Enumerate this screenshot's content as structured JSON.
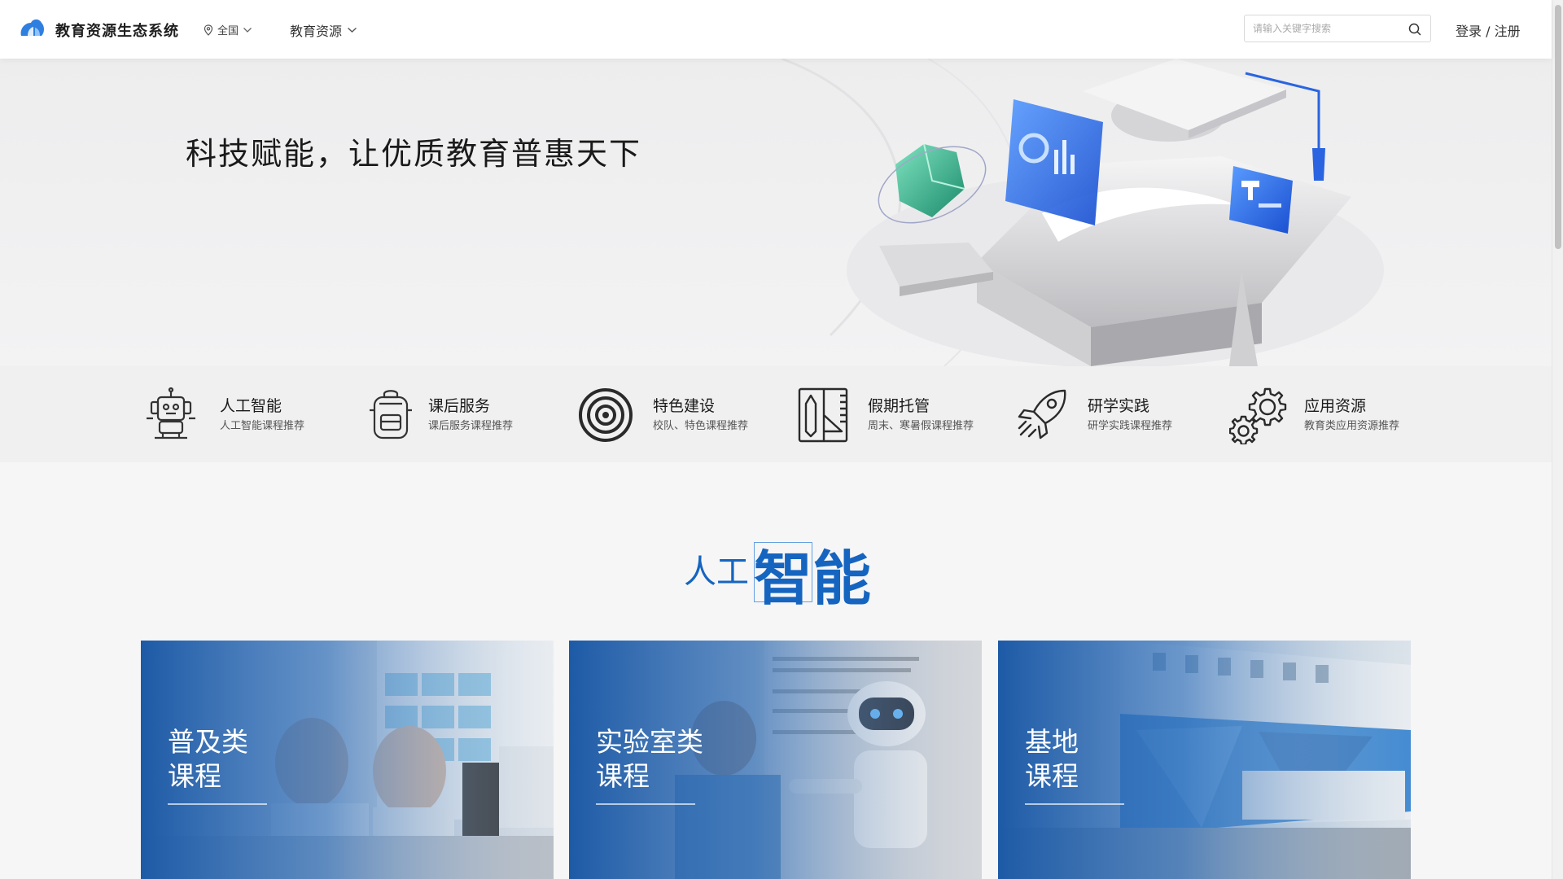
{
  "header": {
    "brand": "教育资源生态系统",
    "region": "全国",
    "nav_resources": "教育资源",
    "search_placeholder": "请输入关键字搜索",
    "login": "登录 / 注册"
  },
  "hero": {
    "title": "科技赋能，让优质教育普惠天下"
  },
  "categories": [
    {
      "title": "人工智能",
      "subtitle": "人工智能课程推荐",
      "icon": "robot-icon"
    },
    {
      "title": "课后服务",
      "subtitle": "课后服务课程推荐",
      "icon": "backpack-icon"
    },
    {
      "title": "特色建设",
      "subtitle": "校队、特色课程推荐",
      "icon": "target-icon"
    },
    {
      "title": "假期托管",
      "subtitle": "周末、寒暑假课程推荐",
      "icon": "ruler-pencil-icon"
    },
    {
      "title": "研学实践",
      "subtitle": "研学实践课程推荐",
      "icon": "rocket-icon"
    },
    {
      "title": "应用资源",
      "subtitle": "教育类应用资源推荐",
      "icon": "gears-icon"
    }
  ],
  "section": {
    "title_small": "人工",
    "title_big": "智能"
  },
  "cards": [
    {
      "title": "普及类\n课程",
      "line1": "普及类",
      "line2": "课程"
    },
    {
      "title": "实验室类\n课程",
      "line1": "实验室类",
      "line2": "课程"
    },
    {
      "title": "基地\n课程",
      "line1": "基地",
      "line2": "课程"
    }
  ],
  "colors": {
    "accent": "#1565c0",
    "card_blue": "#1a5ea8",
    "background": "#f6f6f7"
  }
}
